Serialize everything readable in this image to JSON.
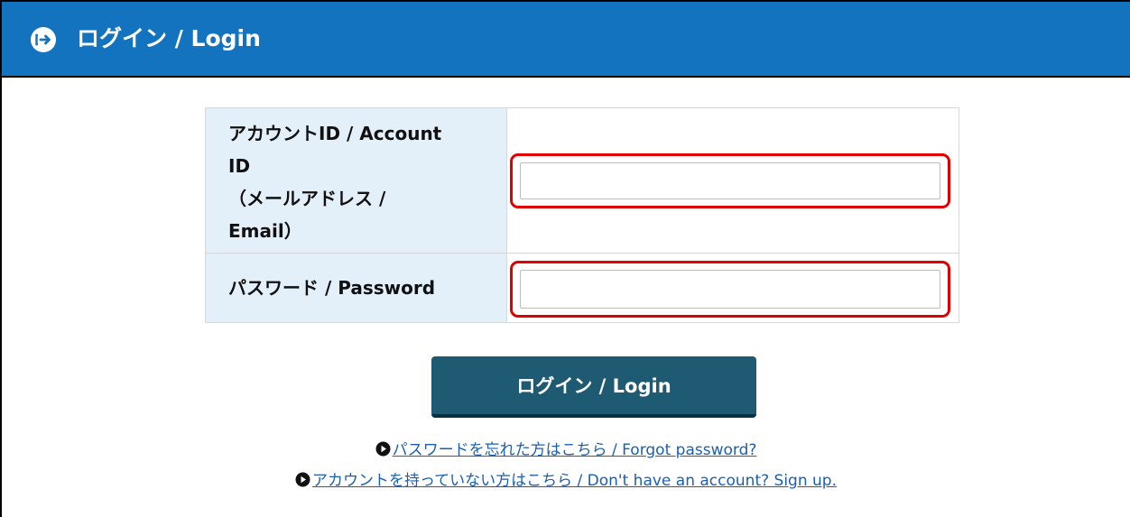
{
  "header": {
    "title": "ログイン / Login",
    "icon": "login-arrow-circle-icon",
    "background_color": "#1473bf"
  },
  "form": {
    "account_label_lines": [
      "アカウントID / Account",
      "ID",
      "（メールアドレス /",
      "Email）"
    ],
    "account_input_value": "",
    "account_input_placeholder": "",
    "password_label": "パスワード / Password",
    "password_input_value": "",
    "password_input_placeholder": "",
    "highlight_color": "#e00000"
  },
  "login_button": {
    "label": "ログイン / Login",
    "color": "#1f5a73"
  },
  "links": {
    "forgot_password": "パスワードを忘れた方はこちら / Forgot password?",
    "sign_up": "アカウントを持っていない方はこちら / Don't have an account? Sign up.",
    "icon": "play-circle-icon",
    "link_color": "#1a5fb4"
  }
}
